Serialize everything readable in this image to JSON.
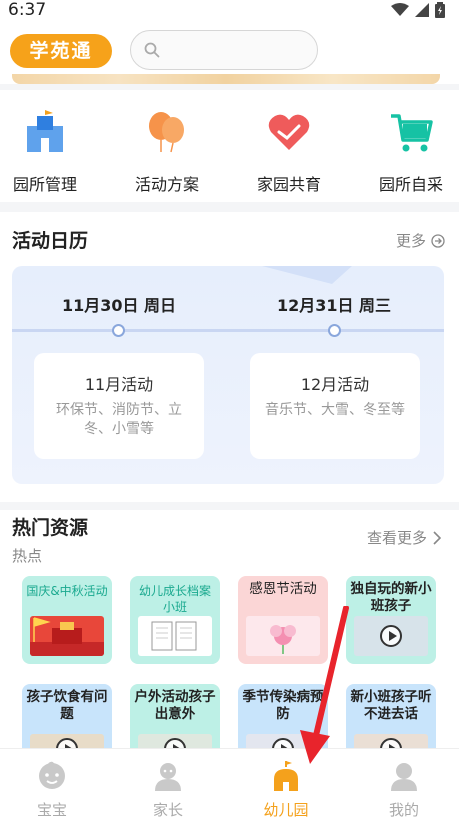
{
  "status_bar": {
    "time": "6:37"
  },
  "header": {
    "logo": "学苑通",
    "search_placeholder": ""
  },
  "quick_nav": [
    {
      "label": "园所管理",
      "icon": "school-building-icon"
    },
    {
      "label": "活动方案",
      "icon": "balloons-icon"
    },
    {
      "label": "家园共育",
      "icon": "heart-handshake-icon"
    },
    {
      "label": "园所自采",
      "icon": "shopping-cart-icon"
    }
  ],
  "calendar": {
    "title": "活动日历",
    "more": "更多",
    "columns": [
      {
        "date": "11月30日 周日",
        "box_title": "11月活动",
        "box_desc": "环保节、消防节、立冬、小雪等"
      },
      {
        "date": "12月31日 周三",
        "box_title": "12月活动",
        "box_desc": "音乐节、大雪、冬至等"
      }
    ]
  },
  "hot": {
    "title": "热门资源",
    "subtitle": "热点",
    "more": "查看更多",
    "cards": [
      {
        "title": "国庆&中秋活动",
        "bg": "#bdf0e6"
      },
      {
        "title": "幼儿成长档案小班",
        "bg": "#bdf0e6"
      },
      {
        "title": "感恩节活动",
        "bg": "#fbd6d6"
      },
      {
        "title": "独自玩的新小班孩子",
        "bg": "#bdf0e6"
      },
      {
        "title": "孩子饮食有问题",
        "bg": "#c8e4fb"
      },
      {
        "title": "户外活动孩子出意外",
        "bg": "#bdf0e6"
      },
      {
        "title": "季节传染病预防",
        "bg": "#c8e4fb"
      },
      {
        "title": "新小班孩子听不进去话",
        "bg": "#c8e4fb"
      }
    ]
  },
  "tabbar": [
    {
      "label": "宝宝",
      "active": false
    },
    {
      "label": "家长",
      "active": false
    },
    {
      "label": "幼儿园",
      "active": true
    },
    {
      "label": "我的",
      "active": false
    }
  ],
  "colors": {
    "accent": "#f4a11c",
    "annotation_arrow": "#e8242c"
  }
}
